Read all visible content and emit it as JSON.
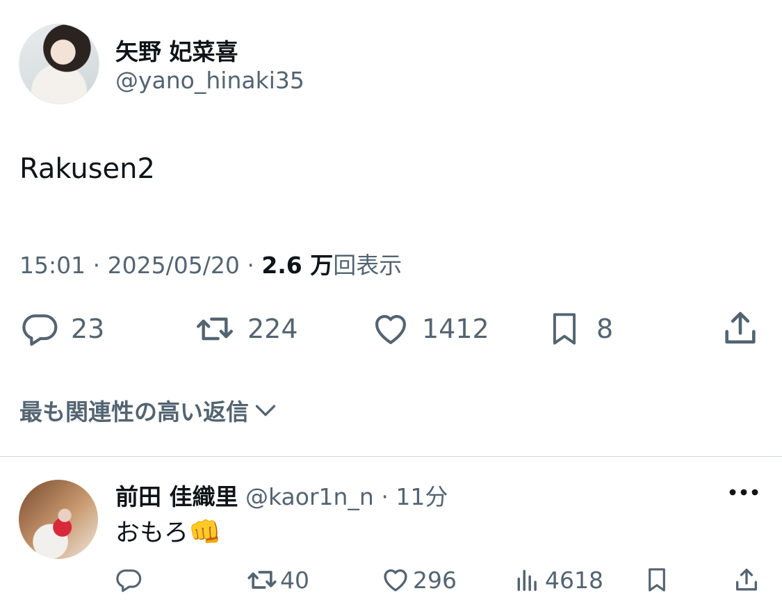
{
  "tweet": {
    "author_name": "矢野 妃菜喜",
    "author_handle": "@yano_hinaki35",
    "text": "Rakusen2",
    "time": "15:01",
    "date": "2025/05/20",
    "sep": "·",
    "views_count": "2.6 万",
    "views_label": "回表示",
    "stats": {
      "replies": "23",
      "retweets": "224",
      "likes": "1412",
      "bookmarks": "8"
    }
  },
  "replies_sort": {
    "label": "最も関連性の高い返信"
  },
  "reply": {
    "author_name": "前田 佳織里",
    "author_handle": "@kaor1n_n",
    "sep": "·",
    "time": "11分",
    "text": "おもろ",
    "emoji": "👊",
    "stats": {
      "retweets": "40",
      "likes": "296",
      "views": "4618"
    }
  },
  "icons": {
    "reply": "reply-icon",
    "retweet": "retweet-icon",
    "like": "heart-icon",
    "bookmark": "bookmark-icon",
    "share": "share-icon",
    "views": "analytics-icon",
    "more": "more-icon",
    "chevron": "chevron-down-icon"
  },
  "colors": {
    "text": "#0f1419",
    "secondary": "#536471",
    "divider": "#cfd9de"
  }
}
